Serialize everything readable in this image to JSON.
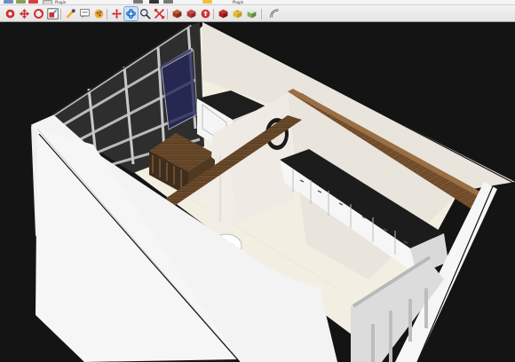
{
  "toolbar": {
    "plugin_label_1": "Plugin",
    "plugin_label_2": "Plugin",
    "tools": [
      {
        "name": "select-icon"
      },
      {
        "name": "move-icon"
      },
      {
        "name": "rotate-icon"
      },
      {
        "name": "scale-icon"
      },
      {
        "name": "tape-measure-icon"
      },
      {
        "name": "dimension-icon"
      },
      {
        "name": "paint-bucket-icon"
      },
      {
        "name": "pan-icon"
      },
      {
        "name": "orbit-icon"
      },
      {
        "name": "zoom-icon"
      },
      {
        "name": "zoom-extents-icon"
      },
      {
        "name": "components-icon"
      },
      {
        "name": "materials-icon"
      },
      {
        "name": "warehouse-icon"
      },
      {
        "name": "extension-icon"
      },
      {
        "name": "solid-tools-icon"
      },
      {
        "name": "sandbox-icon"
      },
      {
        "name": "follow-me-icon"
      }
    ],
    "active_tool": "orbit-icon",
    "colors": {
      "accent_red": "#d32f2f",
      "accent_green": "#2e7d32",
      "accent_blue": "#1565c0",
      "accent_yellow": "#f9a825"
    }
  },
  "viewport": {
    "background": "#141414",
    "model": "room-with-kitchen-counters",
    "colors": {
      "wall": "#ffffff",
      "floor": "#f3eee2",
      "counter_top": "#1d1d1d",
      "cabinet": "#f5f5f5",
      "wood_shelf": "#6b4a2b",
      "window_frame": "#c8c8c8",
      "window_glass": "#3c3c3c"
    }
  }
}
